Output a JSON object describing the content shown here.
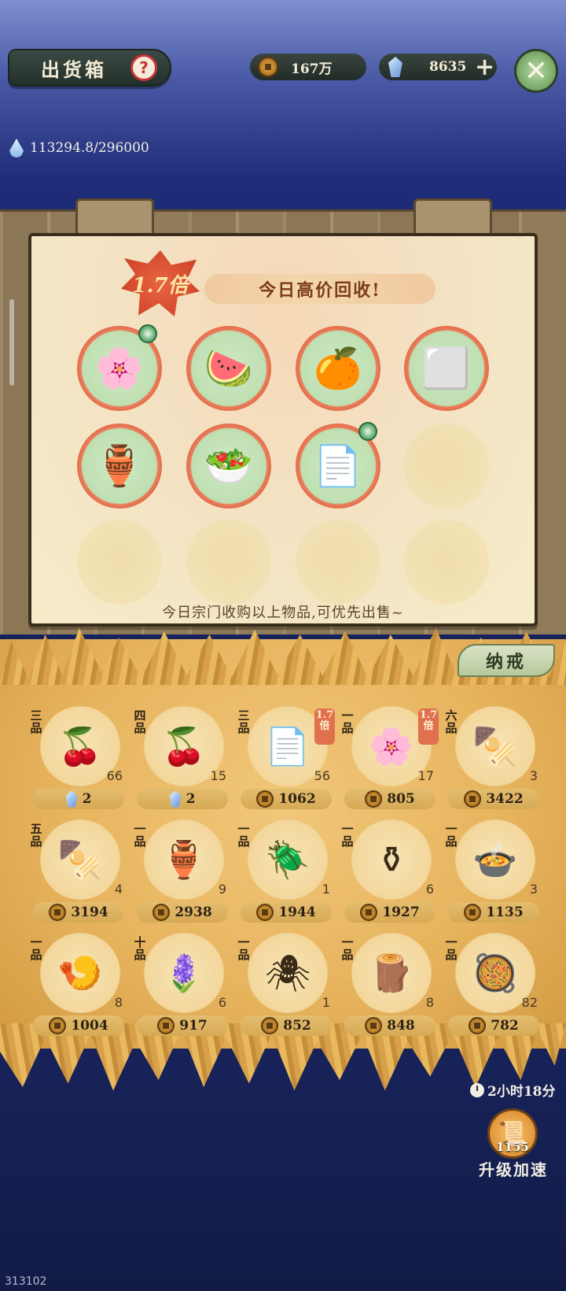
{
  "header": {
    "title": "出货箱",
    "help_symbol": "?",
    "coins": "167万",
    "gems": "8635",
    "plus": "+",
    "close": "✕"
  },
  "water": {
    "value": "113294.8/296000"
  },
  "notice": {
    "multiplier": "1.7倍",
    "banner": "今日高价回收!",
    "footer": "今日宗门收购以上物品,可优先出售~",
    "slots": [
      {
        "icon": "pink-flower",
        "art": "🌸"
      },
      {
        "icon": "watermelon",
        "art": "🍉"
      },
      {
        "icon": "orange-fruit",
        "art": "🍊"
      },
      {
        "icon": "tofu-block",
        "art": "⬜"
      },
      {
        "icon": "clay-jar",
        "art": "🏺"
      },
      {
        "icon": "dish-plate",
        "art": "🥗"
      },
      {
        "icon": "paper-sheets",
        "art": "📄"
      }
    ]
  },
  "storage": {
    "tab_label": "纳戒"
  },
  "inventory": [
    {
      "grade": "三品",
      "icon": "red-berries",
      "art": "🍒",
      "count": "66",
      "price": "2",
      "currency": "gem",
      "mult": ""
    },
    {
      "grade": "四品",
      "icon": "red-berries",
      "art": "🍒",
      "count": "15",
      "price": "2",
      "currency": "gem",
      "mult": ""
    },
    {
      "grade": "三品",
      "icon": "paper-sheets",
      "art": "📄",
      "count": "56",
      "price": "1062",
      "currency": "coin",
      "mult": "1.7倍"
    },
    {
      "grade": "一品",
      "icon": "pink-flower",
      "art": "🌸",
      "count": "17",
      "price": "805",
      "currency": "coin",
      "mult": "1.7倍"
    },
    {
      "grade": "六品",
      "icon": "grilled-box",
      "art": "🍢",
      "count": "3",
      "price": "3422",
      "currency": "coin",
      "mult": ""
    },
    {
      "grade": "五品",
      "icon": "grilled-box",
      "art": "🍢",
      "count": "4",
      "price": "3194",
      "currency": "coin",
      "mult": ""
    },
    {
      "grade": "一品",
      "icon": "clay-jar",
      "art": "🏺",
      "count": "9",
      "price": "2938",
      "currency": "coin",
      "mult": ""
    },
    {
      "grade": "一品",
      "icon": "beetle",
      "art": "🪲",
      "count": "1",
      "price": "1944",
      "currency": "coin",
      "mult": ""
    },
    {
      "grade": "一品",
      "icon": "vase",
      "art": "⚱",
      "count": "6",
      "price": "1927",
      "currency": "coin",
      "mult": ""
    },
    {
      "grade": "一品",
      "icon": "soup-pot",
      "art": "🍲",
      "count": "3",
      "price": "1135",
      "currency": "coin",
      "mult": ""
    },
    {
      "grade": "一品",
      "icon": "roasted-skewers",
      "art": "🍤",
      "count": "8",
      "price": "1004",
      "currency": "coin",
      "mult": ""
    },
    {
      "grade": "十品",
      "icon": "blue-flowers-leaf",
      "art": "🪻",
      "count": "6",
      "price": "917",
      "currency": "coin",
      "mult": ""
    },
    {
      "grade": "一品",
      "icon": "spider",
      "art": "🕷",
      "count": "1",
      "price": "852",
      "currency": "coin",
      "mult": ""
    },
    {
      "grade": "一品",
      "icon": "dark-stick",
      "art": "🪵",
      "count": "8",
      "price": "848",
      "currency": "coin",
      "mult": ""
    },
    {
      "grade": "一品",
      "icon": "bean-bowl",
      "art": "🥘",
      "count": "82",
      "price": "782",
      "currency": "coin",
      "mult": ""
    }
  ],
  "timer": {
    "text": "2小时18分"
  },
  "speed_up": {
    "count": "1155",
    "label": "升级加速",
    "art": "📜"
  },
  "footer_id": "313102"
}
